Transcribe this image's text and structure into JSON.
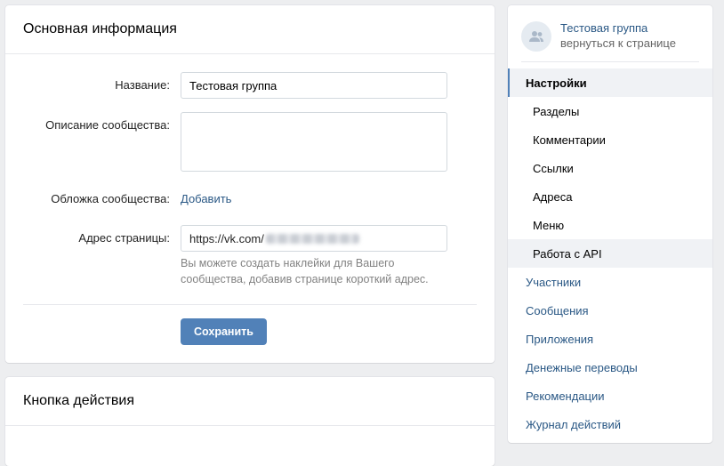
{
  "main": {
    "title": "Основная информация",
    "name_label": "Название:",
    "name_value": "Тестовая группа",
    "desc_label": "Описание сообщества:",
    "desc_value": "",
    "cover_label": "Обложка сообщества:",
    "cover_action": "Добавить",
    "address_label": "Адрес страницы:",
    "address_prefix": "https://vk.com/",
    "address_hint": "Вы можете создать наклейки для Вашего сообщества, добавив странице короткий адрес.",
    "save_label": "Сохранить"
  },
  "action_card": {
    "title": "Кнопка действия"
  },
  "sidebar": {
    "group_name": "Тестовая группа",
    "back_label": "вернуться к странице",
    "items": [
      {
        "label": "Настройки",
        "state": "active"
      },
      {
        "label": "Разделы",
        "state": "sub"
      },
      {
        "label": "Комментарии",
        "state": "sub"
      },
      {
        "label": "Ссылки",
        "state": "sub"
      },
      {
        "label": "Адреса",
        "state": "sub"
      },
      {
        "label": "Меню",
        "state": "sub"
      },
      {
        "label": "Работа с API",
        "state": "sub-hover"
      },
      {
        "label": "Участники",
        "state": "normal"
      },
      {
        "label": "Сообщения",
        "state": "normal"
      },
      {
        "label": "Приложения",
        "state": "normal"
      },
      {
        "label": "Денежные переводы",
        "state": "normal"
      },
      {
        "label": "Рекомендации",
        "state": "normal"
      },
      {
        "label": "Журнал действий",
        "state": "normal"
      }
    ]
  },
  "icons": {
    "group_avatar": "group-users-icon"
  },
  "colors": {
    "accent": "#5181b8",
    "link": "#2a5885",
    "background": "#edeef0"
  }
}
